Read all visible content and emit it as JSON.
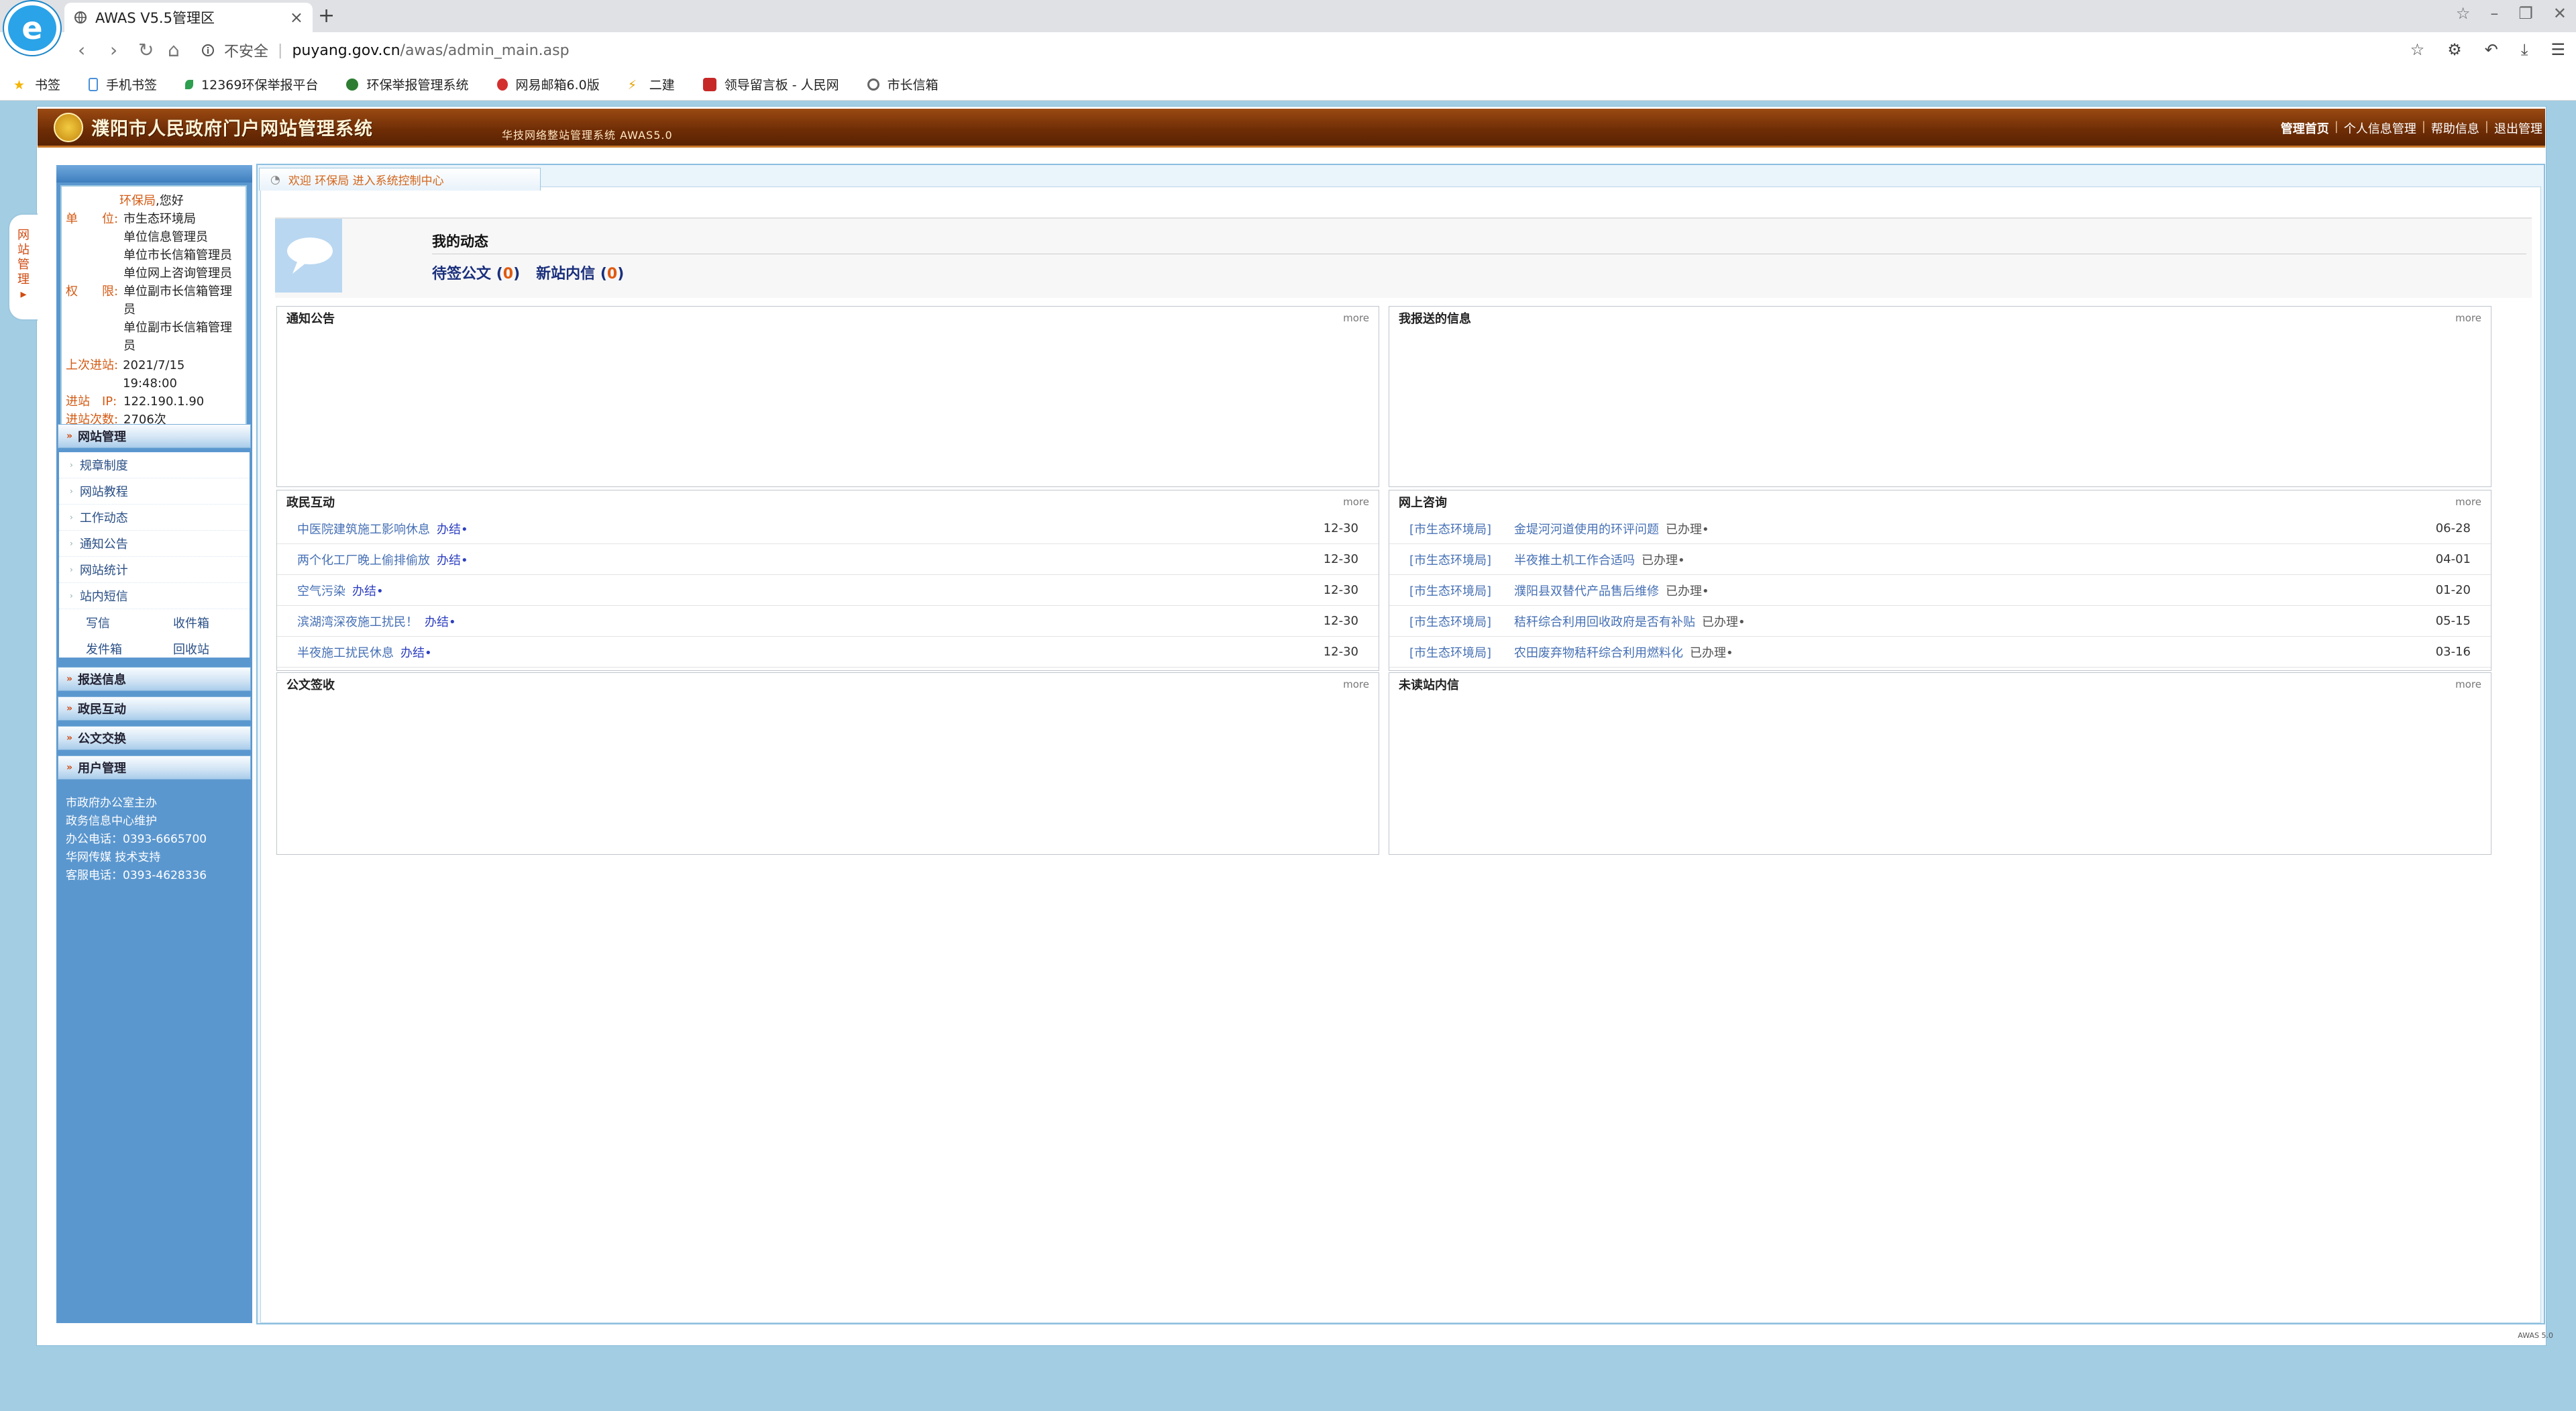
{
  "browser": {
    "logo_glyph": "e",
    "tab_title": "AWAS V5.5管理区",
    "tab_close": "×",
    "new_tab": "+",
    "window_controls": [
      "☆",
      "–",
      "❐",
      "✕"
    ],
    "nav_buttons": [
      "‹",
      "›",
      "↻",
      "⌂"
    ],
    "security_label": "不安全",
    "separator": "|",
    "url_host": "puyang.gov.cn",
    "url_path": "/awas/admin_main.asp",
    "right_icons": [
      "☆",
      "⚙",
      "↶",
      "⤓",
      "☰"
    ],
    "bookmarks": [
      "书签",
      "手机书签",
      "12369环保举报平台",
      "环保举报管理系统",
      "网易邮箱6.0版",
      "二建",
      "领导留言板 - 人民网",
      "市长信箱"
    ],
    "bookmark_colors": [
      "#f4b400",
      "#4a90d9",
      "#2e9e4f",
      "#2e7d32",
      "#d32f2f",
      "#e5a100",
      "#c62828",
      "#666666"
    ]
  },
  "header": {
    "site_title": "濮阳市人民政府门户网站管理系统",
    "system_name": "华技网络整站管理系统 AWAS5.0",
    "links": [
      "管理首页",
      "个人信息管理",
      "帮助信息",
      "退出管理"
    ],
    "link_sep": "|"
  },
  "side_tab": {
    "chars": [
      "网",
      "站",
      "管",
      "理"
    ],
    "arrow": "▸"
  },
  "user": {
    "greeting_name": "环保局",
    "greeting_suffix": ",您好",
    "unit_label": "单　　位:",
    "unit_lines": [
      "市生态环境局",
      "单位信息管理员",
      "单位市长信箱管理员",
      "单位网上咨询管理员"
    ],
    "perm_label": "权　　限:",
    "perm_lines": [
      "单位副市长信箱管理员",
      "单位副市长信箱管理员"
    ],
    "last_login_label": "上次进站:",
    "last_login": "2021/7/15 19:48:00",
    "ip_label": "进站　IP:",
    "ip": "122.190.1.90",
    "visits_label": "进站次数:",
    "visits": "2706次"
  },
  "nav": {
    "arrow": "»",
    "item_dot": "›",
    "site_mgmt": "网站管理",
    "items": [
      "规章制度",
      "网站教程",
      "工作动态",
      "通知公告",
      "网站统计",
      "站内短信"
    ],
    "sub_items": [
      "写信",
      "收件箱",
      "发件箱",
      "回收站"
    ],
    "sections": [
      "报送信息",
      "政民互动",
      "公文交换",
      "用户管理"
    ]
  },
  "footer": {
    "lines": [
      "市政府办公室主办",
      "政务信息中心维护",
      "办公电话：0393-6665700",
      "华网传媒 技术支持",
      "客服电话：0393-4628336"
    ]
  },
  "welcome": {
    "icon": "◔",
    "text": "欢迎 环保局 进入系统控制中心"
  },
  "dynamics": {
    "title": "我的动态",
    "pending_label": "待签公文",
    "pending_count": "0",
    "mail_label": "新站内信",
    "mail_count": "0",
    "paren_open": "(",
    "paren_close": ")"
  },
  "panels": {
    "more": "more",
    "notice": {
      "title": "通知公告"
    },
    "reported": {
      "title": "我报送的信息"
    },
    "interaction": {
      "title": "政民互动",
      "rows": [
        {
          "title": "中医院建筑施工影响休息",
          "status": "办结•",
          "date": "12-30"
        },
        {
          "title": "两个化工厂晚上偷排偷放",
          "status": "办结•",
          "date": "12-30"
        },
        {
          "title": "空气污染",
          "status": "办结•",
          "date": "12-30"
        },
        {
          "title": "滨湖湾深夜施工扰民！",
          "status": "办结•",
          "date": "12-30"
        },
        {
          "title": "半夜施工扰民休息",
          "status": "办结•",
          "date": "12-30"
        }
      ]
    },
    "consult": {
      "title": "网上咨询",
      "rows": [
        {
          "dept": "[市生态环境局]",
          "title": "金堤河河道使用的环评问题",
          "status": "已办理•",
          "date": "06-28"
        },
        {
          "dept": "[市生态环境局]",
          "title": "半夜推土机工作合适吗",
          "status": "已办理•",
          "date": "04-01"
        },
        {
          "dept": "[市生态环境局]",
          "title": "濮阳县双替代产品售后维修",
          "status": "已办理•",
          "date": "01-20"
        },
        {
          "dept": "[市生态环境局]",
          "title": "秸秆综合利用回收政府是否有补贴",
          "status": "已办理•",
          "date": "05-15"
        },
        {
          "dept": "[市生态环境局]",
          "title": "农田废弃物秸秆综合利用燃料化",
          "status": "已办理•",
          "date": "03-16"
        }
      ]
    },
    "docs": {
      "title": "公文签收"
    },
    "unread": {
      "title": "未读站内信"
    }
  },
  "version": "AWAS 5.0"
}
